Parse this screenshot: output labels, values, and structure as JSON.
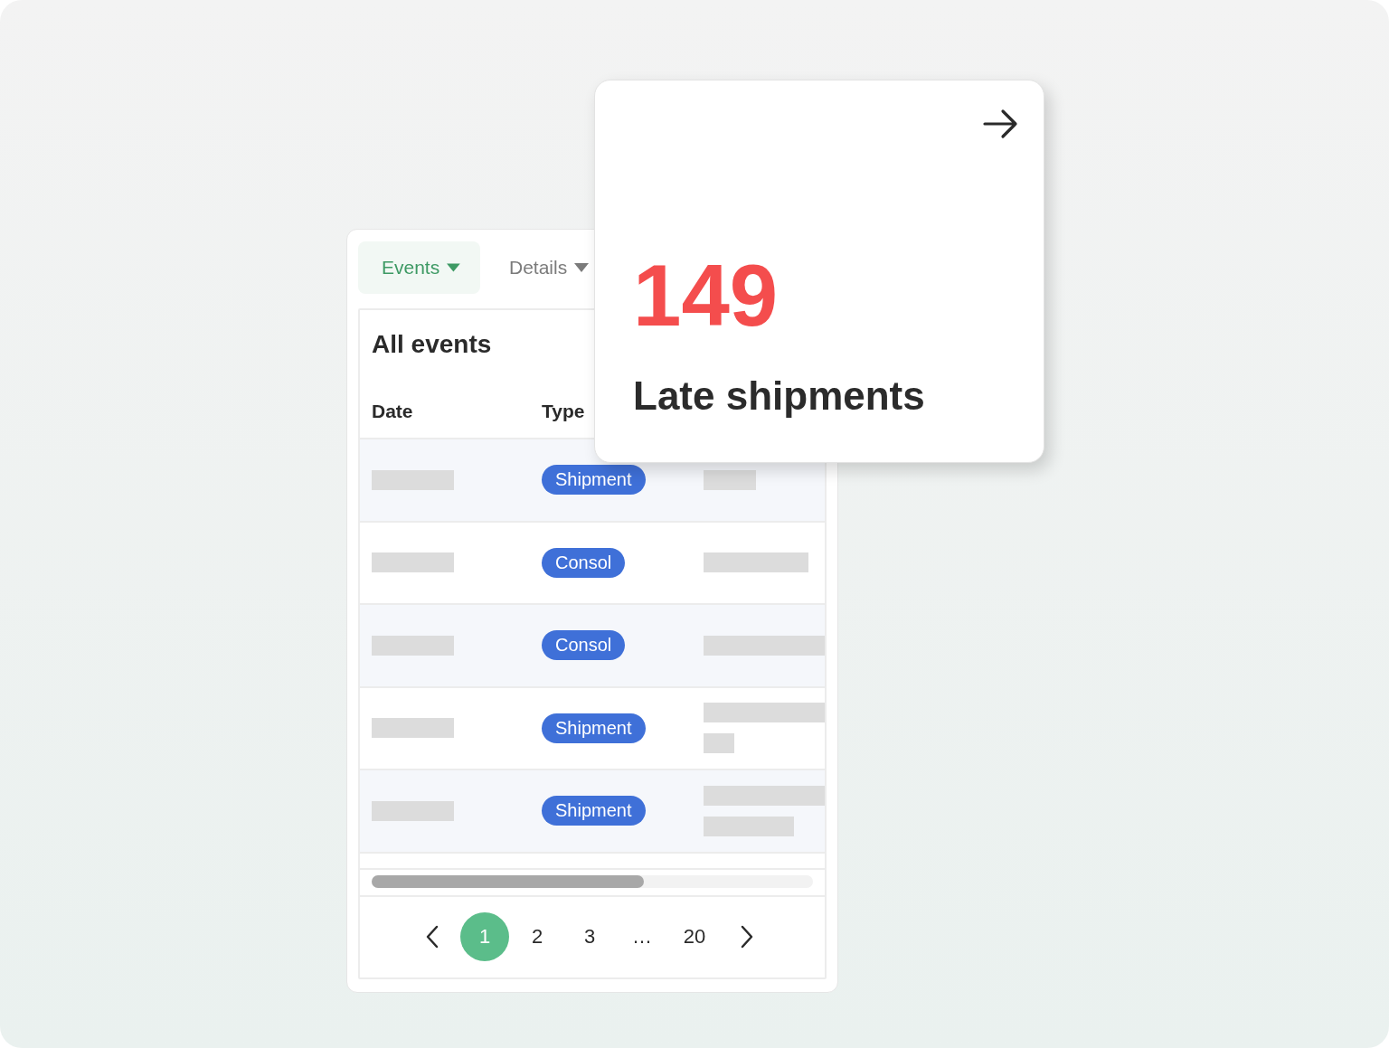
{
  "tabs": [
    {
      "label": "Events",
      "selected": true
    },
    {
      "label": "Details",
      "selected": false
    }
  ],
  "table": {
    "title": "All events",
    "columns": [
      "Date",
      "Type"
    ],
    "rows": [
      {
        "type": "Shipment"
      },
      {
        "type": "Consol"
      },
      {
        "type": "Consol"
      },
      {
        "type": "Shipment"
      },
      {
        "type": "Shipment"
      }
    ]
  },
  "pagination": {
    "pages": [
      {
        "label": "1",
        "selected": true
      },
      {
        "label": "2",
        "selected": false
      },
      {
        "label": "3",
        "selected": false
      },
      {
        "label": "…",
        "selected": false
      },
      {
        "label": "20",
        "selected": false
      }
    ]
  },
  "stat_card": {
    "value": "149",
    "label": "Late shipments"
  }
}
